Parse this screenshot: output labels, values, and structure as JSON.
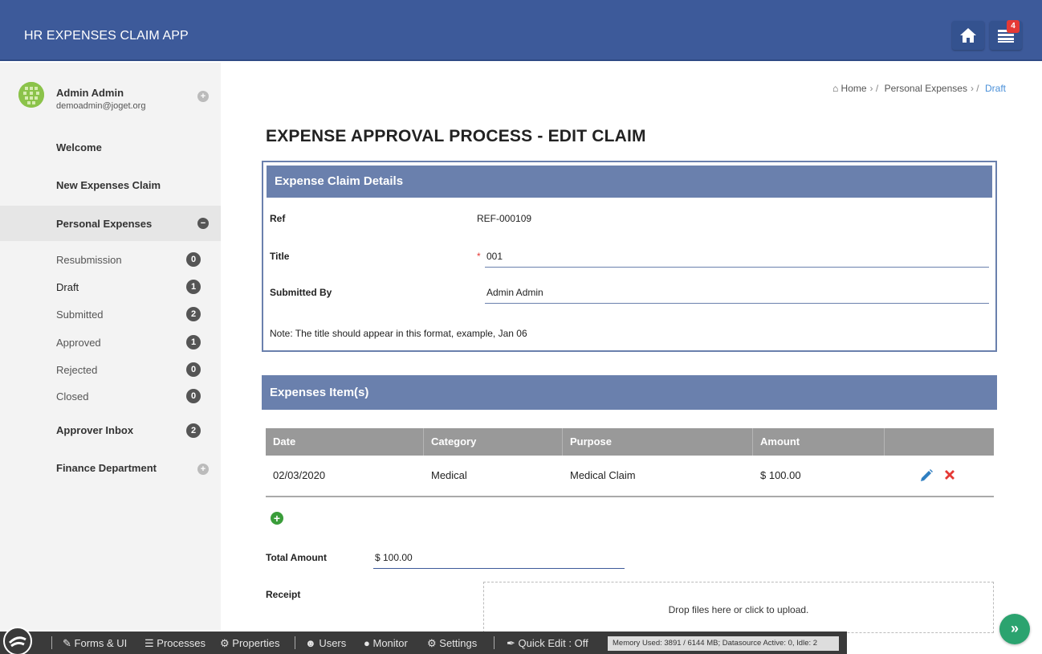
{
  "app": {
    "title": "HR EXPENSES CLAIM APP",
    "notification_count": "4",
    "accent": "#3d5a9a"
  },
  "user": {
    "name": "Admin Admin",
    "email": "demoadmin@joget.org"
  },
  "sidebar": {
    "welcome": "Welcome",
    "new_claim": "New Expenses Claim",
    "personal_expenses": "Personal Expenses",
    "sub": [
      {
        "label": "Resubmission",
        "count": "0"
      },
      {
        "label": "Draft",
        "count": "1"
      },
      {
        "label": "Submitted",
        "count": "2"
      },
      {
        "label": "Approved",
        "count": "1"
      },
      {
        "label": "Rejected",
        "count": "0"
      },
      {
        "label": "Closed",
        "count": "0"
      }
    ],
    "approver_inbox": {
      "label": "Approver Inbox",
      "count": "2"
    },
    "finance": "Finance Department"
  },
  "breadcrumb": {
    "home": "Home",
    "section": "Personal Expenses",
    "current": "Draft"
  },
  "page_title": "EXPENSE APPROVAL PROCESS - EDIT CLAIM",
  "claim": {
    "heading": "Expense Claim Details",
    "ref_label": "Ref",
    "ref_value": "REF-000109",
    "title_label": "Title",
    "title_value": "001",
    "required_mark": "*",
    "submitted_label": "Submitted By",
    "submitted_value": "Admin Admin",
    "note": "Note: The title should appear in this format, example, Jan 06"
  },
  "items": {
    "heading": "Expenses Item(s)",
    "columns": [
      "Date",
      "Category",
      "Purpose",
      "Amount"
    ],
    "rows": [
      {
        "date": "02/03/2020",
        "category": "Medical",
        "purpose": "Medical Claim",
        "amount": "$ 100.00"
      }
    ]
  },
  "total": {
    "label": "Total Amount",
    "value": "$ 100.00"
  },
  "receipt": {
    "label": "Receipt",
    "dropzone": "Drop files here or click to upload."
  },
  "bottombar": {
    "forms": "Forms & UI",
    "processes": "Processes",
    "properties": "Properties",
    "users": "Users",
    "monitor": "Monitor",
    "settings": "Settings",
    "quick_edit": "Quick Edit : Off",
    "memory": "Memory Used: 3891 / 6144 MB; Datasource Active: 0, Idle: 2"
  }
}
